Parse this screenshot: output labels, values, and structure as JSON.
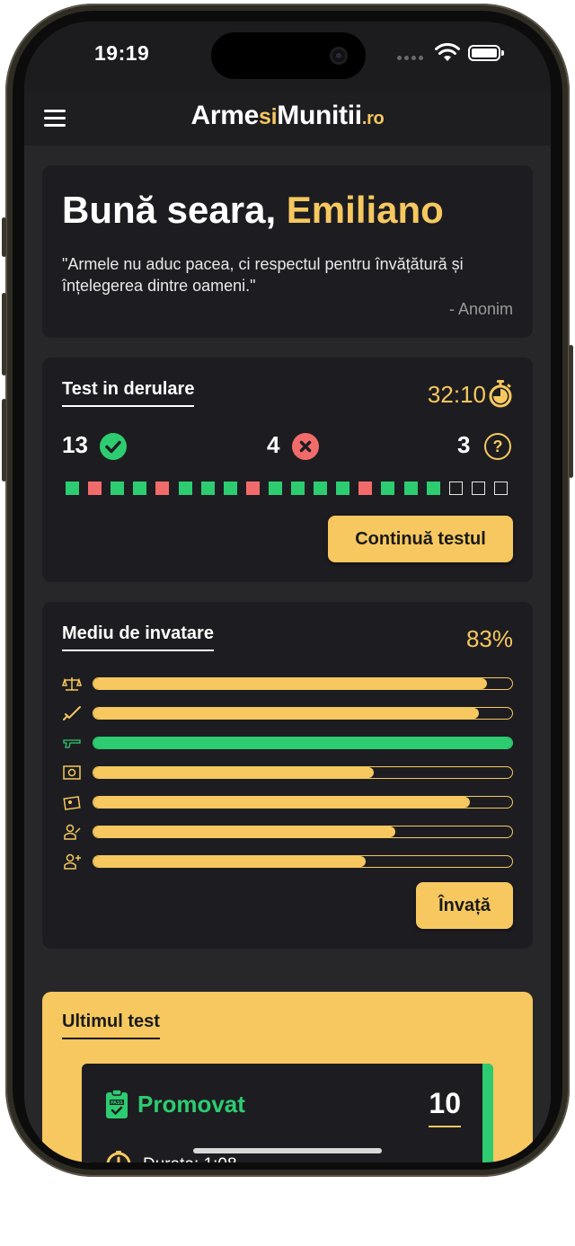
{
  "status": {
    "time": "19:19"
  },
  "header": {
    "logo_part1": "Arme",
    "logo_part2": "si",
    "logo_part3": "Munitii",
    "logo_part4": ".ro"
  },
  "greeting": {
    "text": "Bună seara, ",
    "name": "Emiliano",
    "quote": "\"Armele nu aduc pacea, ci respectul pentru învățătură și înțelegerea dintre oameni.\"",
    "author": "- Anonim"
  },
  "current_test": {
    "title": "Test in derulare",
    "timer": "32:10",
    "correct": "13",
    "wrong": "4",
    "unanswered": "3",
    "answers": [
      "c",
      "w",
      "c",
      "c",
      "w",
      "c",
      "c",
      "c",
      "w",
      "c",
      "c",
      "c",
      "c",
      "w",
      "c",
      "c",
      "c",
      "u",
      "u",
      "u"
    ],
    "button": "Continuă testul"
  },
  "learning": {
    "title": "Mediu de invatare",
    "percent": "83%",
    "topics": [
      {
        "icon": "scales-icon",
        "progress": 0.94
      },
      {
        "icon": "rifle-icon",
        "progress": 0.92
      },
      {
        "icon": "pistol-icon",
        "progress": 1.0,
        "complete": true
      },
      {
        "icon": "safe-icon",
        "progress": 0.67
      },
      {
        "icon": "id-card-icon",
        "progress": 0.9
      },
      {
        "icon": "judge-icon",
        "progress": 0.72
      },
      {
        "icon": "medic-icon",
        "progress": 0.65
      }
    ],
    "button": "Învață"
  },
  "last_test": {
    "title": "Ultimul test",
    "result": "Promovat",
    "score": "10",
    "duration": "Durata: 1:08"
  },
  "colors": {
    "accent": "#f6c85f",
    "correct": "#2ecc71",
    "wrong": "#f26b6b",
    "background": "#1c1c1f"
  }
}
